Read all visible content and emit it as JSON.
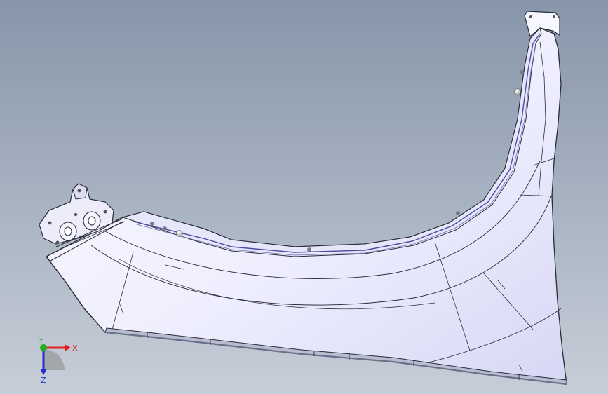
{
  "viewport": {
    "background_top": "#8796aa",
    "background_bottom": "#c7ced8",
    "part_fill": "#f2f2ff",
    "part_shadow": "#d2d4f0",
    "edge_color": "#2a2a38",
    "flange_color": "#9aa0b4"
  },
  "triad": {
    "x_label": "X",
    "y_label": "Y",
    "z_label": "Z",
    "x_color": "#e02020",
    "y_color": "#20b020",
    "z_color": "#2030d0"
  }
}
